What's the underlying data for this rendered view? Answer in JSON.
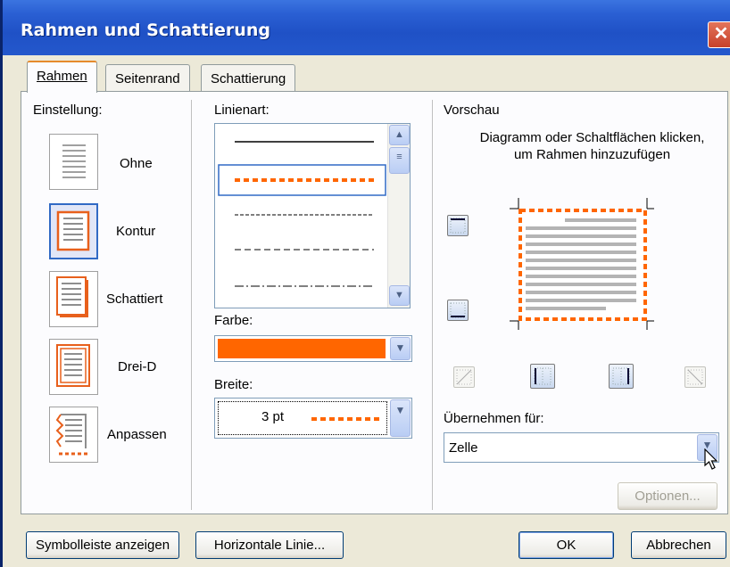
{
  "window": {
    "title": "Rahmen und Schattierung",
    "close_glyph": "✕"
  },
  "tabs": [
    {
      "label": "Rahmen",
      "active": true
    },
    {
      "label": "Seitenrand",
      "active": false
    },
    {
      "label": "Schattierung",
      "active": false
    }
  ],
  "settings": {
    "heading": "Einstellung:",
    "items": [
      {
        "label": "Ohne",
        "selected": false,
        "icon": "none-border-icon"
      },
      {
        "label": "Kontur",
        "selected": true,
        "icon": "box-border-icon"
      },
      {
        "label": "Schattiert",
        "selected": false,
        "icon": "shadow-border-icon"
      },
      {
        "label": "Drei-D",
        "selected": false,
        "icon": "3d-border-icon"
      },
      {
        "label": "Anpassen",
        "selected": false,
        "icon": "custom-border-icon"
      }
    ]
  },
  "line_style": {
    "heading": "Linienart:",
    "selected_index": 1,
    "options": [
      "solid",
      "dotted",
      "dashed-dense",
      "dashed",
      "dash-dot"
    ]
  },
  "color": {
    "label": "Farbe:",
    "value": "#ff6600"
  },
  "width": {
    "label": "Breite:",
    "value": "3 pt"
  },
  "preview": {
    "heading": "Vorschau",
    "hint": "Diagramm oder Schaltflächen klicken, um Rahmen hinzuzufügen",
    "apply_label": "Übernehmen für:",
    "apply_value": "Zelle",
    "options_button": "Optionen..."
  },
  "footer": {
    "toolbar_button": "Symbolleiste anzeigen",
    "hline_button": "Horizontale Linie...",
    "ok_button": "OK",
    "cancel_button": "Abbrechen"
  },
  "colors": {
    "accent": "#ff6600",
    "titlebar": "#2a5fd3",
    "selection": "#316ac5"
  }
}
